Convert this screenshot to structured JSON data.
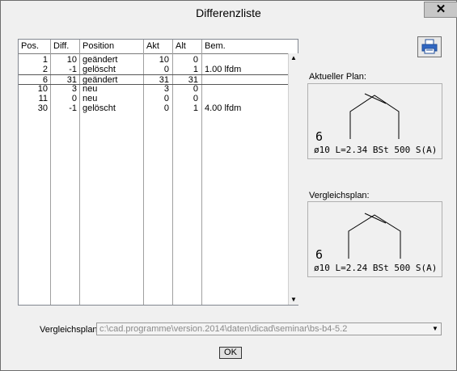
{
  "window": {
    "title": "Differenzliste",
    "close_glyph": "✕"
  },
  "table": {
    "columns": [
      "Pos.",
      "Diff.",
      "Position",
      "Akt",
      "Alt",
      "Bem."
    ],
    "rows": [
      [
        "1",
        "10",
        "geändert",
        "10",
        "0",
        ""
      ],
      [
        "2",
        "-1",
        "gelöscht",
        "0",
        "1",
        "1.00 lfdm"
      ],
      [
        "6",
        "31",
        "geändert",
        "31",
        "31",
        ""
      ],
      [
        "10",
        "3",
        "neu",
        "3",
        "0",
        ""
      ],
      [
        "11",
        "0",
        "neu",
        "0",
        "0",
        ""
      ],
      [
        "30",
        "-1",
        "gelöscht",
        "0",
        "1",
        "4.00 lfdm"
      ]
    ],
    "selected_row": 2
  },
  "toolbar": {
    "print_icon": "printer-icon"
  },
  "current_plan": {
    "label": "Aktueller Plan:",
    "pos": "6",
    "spec": "ø10 L=2.34 BSt 500 S(A)"
  },
  "compare_plan": {
    "label": "Vergleichsplan:",
    "pos": "6",
    "spec": "ø10 L=2.24 BSt 500 S(A)"
  },
  "footer": {
    "label": "Vergleichsplan:",
    "path_value": "c:\\cad.programme\\version.2014\\daten\\dicad\\seminar\\bs-b4-5.2",
    "ok_label": "OK"
  },
  "colors": {
    "accent": "#1f4e9a",
    "background": "#f0f0f0"
  }
}
